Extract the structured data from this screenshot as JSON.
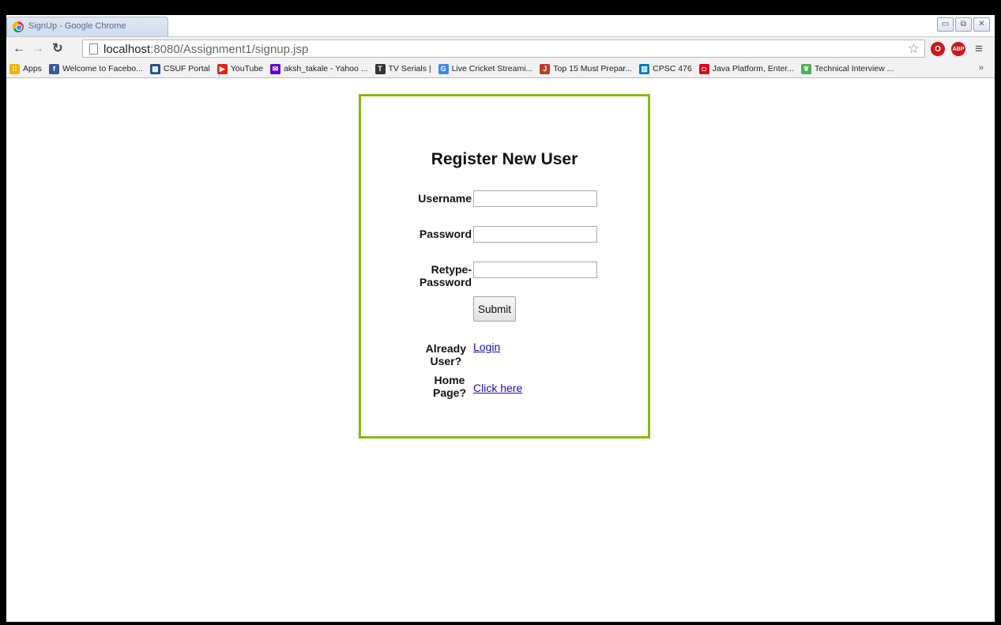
{
  "browser": {
    "tab_title": "SignUp - Google Chrome",
    "url_host": "localhost",
    "url_rest": ":8080/Assignment1/signup.jsp",
    "window_controls": [
      "▭",
      "⧉",
      "✕"
    ],
    "bookmarks": [
      {
        "label": "Apps",
        "icon": "apps-grid-icon",
        "color": "#f4b400"
      },
      {
        "label": "Welcome to Facebo...",
        "icon": "facebook-icon",
        "color": "#3b5998"
      },
      {
        "label": "CSUF Portal",
        "icon": "portal-icon",
        "color": "#1d4f91"
      },
      {
        "label": "YouTube",
        "icon": "youtube-icon",
        "color": "#e62117"
      },
      {
        "label": "aksh_takale - Yahoo ...",
        "icon": "yahoo-mail-icon",
        "color": "#5f01d1"
      },
      {
        "label": "TV Serials |",
        "icon": "tv-icon",
        "color": "#333333"
      },
      {
        "label": "Live Cricket Streami...",
        "icon": "google-icon",
        "color": "#4285f4"
      },
      {
        "label": "Top 15 Must Prepar...",
        "icon": "jm-icon",
        "color": "#c0392b"
      },
      {
        "label": "CPSC 476",
        "icon": "trello-icon",
        "color": "#0079bf"
      },
      {
        "label": "Java Platform, Enter...",
        "icon": "oracle-icon",
        "color": "#e0001b"
      },
      {
        "label": "Technical Interview ...",
        "icon": "leaf-icon",
        "color": "#4caf50"
      }
    ],
    "bookmarks_more": "»"
  },
  "form": {
    "title": "Register New User",
    "username_label": "Username",
    "password_label": "Password",
    "retype_label_1": "Retype-",
    "retype_label_2": "Password",
    "submit_label": "Submit",
    "already_label_1": "Already",
    "already_label_2": "User?",
    "login_link": "Login",
    "home_label_1": "Home",
    "home_label_2": "Page?",
    "home_link": "Click here",
    "border_color": "#86b817"
  }
}
